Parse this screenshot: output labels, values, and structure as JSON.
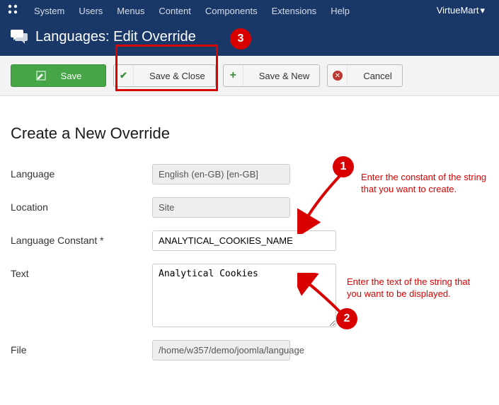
{
  "menubar": {
    "items": [
      {
        "label": "System"
      },
      {
        "label": "Users"
      },
      {
        "label": "Menus"
      },
      {
        "label": "Content"
      },
      {
        "label": "Components"
      },
      {
        "label": "Extensions"
      },
      {
        "label": "Help"
      }
    ],
    "active": "VirtueMart"
  },
  "title": "Languages: Edit Override",
  "toolbar": {
    "save": "Save",
    "save_close": "Save & Close",
    "save_new": "Save & New",
    "cancel": "Cancel"
  },
  "heading": "Create a New Override",
  "form": {
    "language_label": "Language",
    "language_value": "English (en-GB) [en-GB]",
    "location_label": "Location",
    "location_value": "Site",
    "constant_label": "Language Constant *",
    "constant_value": "ANALYTICAL_COOKIES_NAME",
    "text_label": "Text",
    "text_value": "Analytical Cookies",
    "file_label": "File",
    "file_value": "/home/w357/demo/joomla/language"
  },
  "annotations": {
    "n1": "1",
    "n2": "2",
    "n3": "3",
    "tip1": "Enter the constant of the string that you want to create.",
    "tip2": "Enter the text of the string that you want to be displayed."
  }
}
